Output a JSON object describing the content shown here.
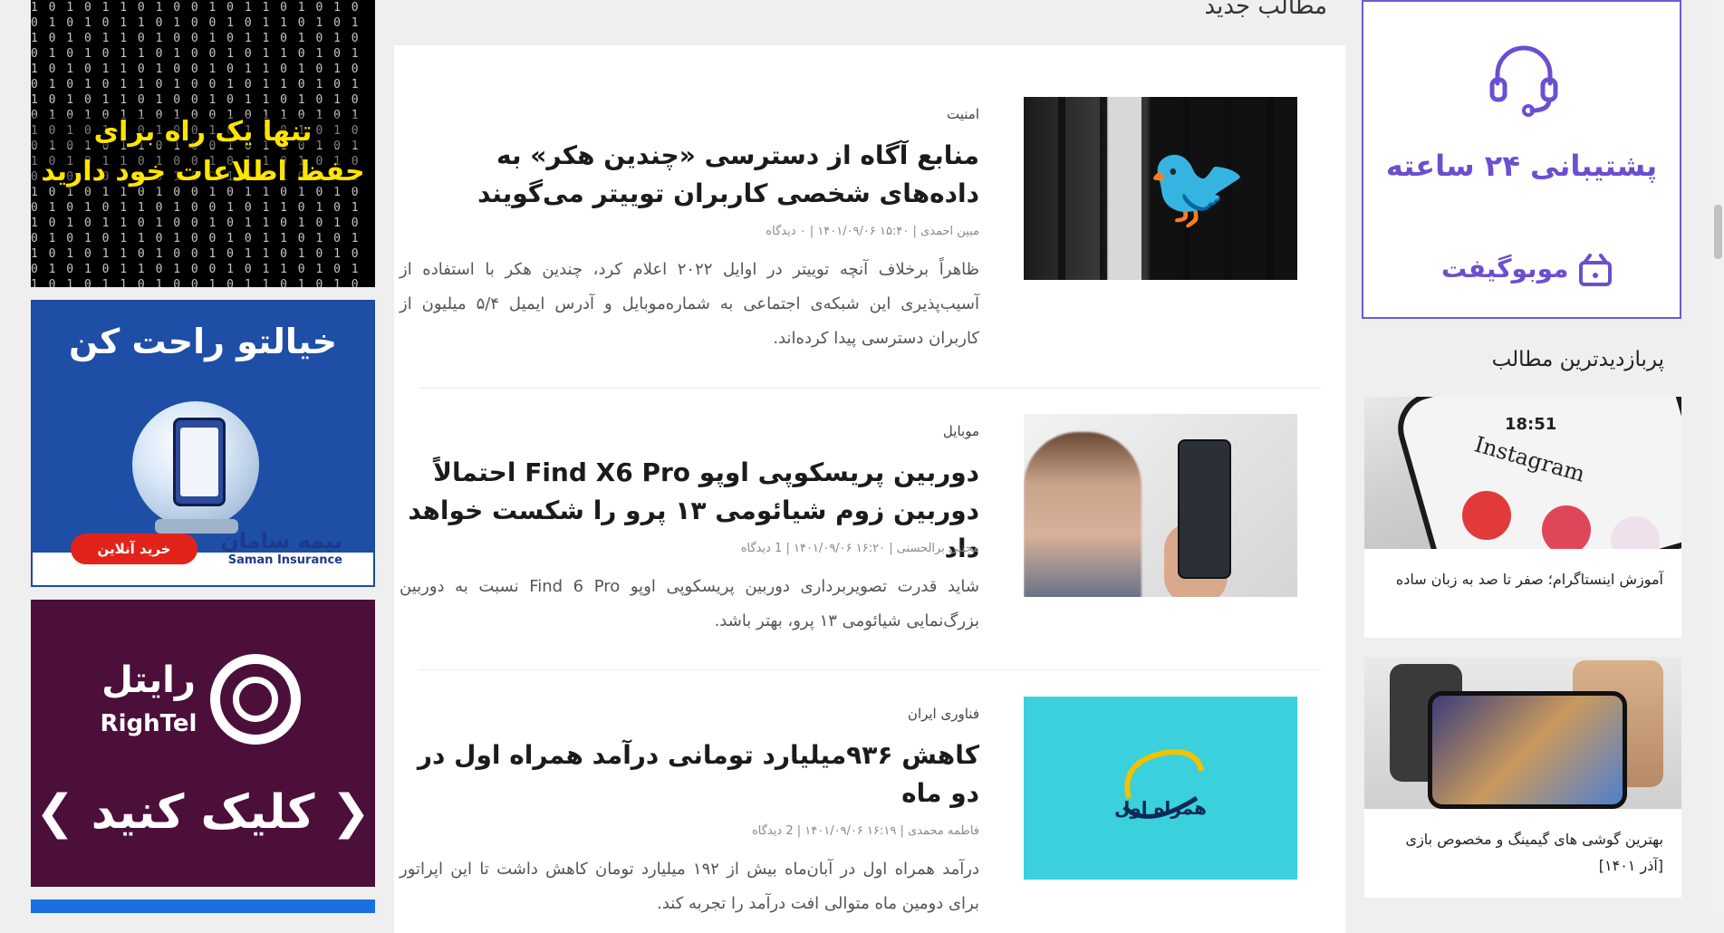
{
  "section": {
    "title": "مطالب جدید"
  },
  "left_ads": {
    "ad1": {
      "line1": "تنها یک راه برای",
      "line2": "حفظ اطلاعات خود دارید",
      "matrix": "1 0 1 0 1 1 0 1 0 0 1 0 1 1 0 1 0 1 0"
    },
    "ad2": {
      "headline": "خیالتو راحت کن",
      "button": "خرید آنلاین",
      "brand_fa": "بیمه سامان",
      "brand_en": "Saman Insurance"
    },
    "ad3": {
      "brand_fa": "رایتل",
      "brand_en": "RighTel",
      "cta": "❮ کلیک کنید ❯"
    }
  },
  "posts": [
    {
      "category": "امنیت",
      "title": "منابع آگاه از دسترسی «چندین هکر» به داده‌های شخصی کاربران توییتر می‌گویند",
      "meta": "مبین احمدی | ۱۵:۴۰ ۱۴۰۱/۰۹/۰۶ | ۰ دیدگاه",
      "excerpt": "ظاهراً برخلاف آنچه توییتر در اوایل ۲۰۲۲ اعلام کرد، چندین هکر با استفاده از آسیب‌پذیری این شبکه‌ی اجتماعی به شماره‌موبایل و آدرس ایمیل ۵/۴ میلیون از کاربران دسترسی پیدا کرده‌اند."
    },
    {
      "category": "موبایل",
      "title": "دوربین پریسکوپی اوپو Find X6 Pro احتمالاً دوربین زوم شیائومی ۱۳ پرو را شکست خواهد داد",
      "meta": "مجتبی برالحسنی | ۱۶:۲۰ ۱۴۰۱/۰۹/۰۶ | 1 دیدگاه",
      "excerpt": "شاید قدرت تصویربرداری دوربین پریسکوپی اوپو Find 6 Pro نسبت به دوربین بزرگ‌نمایی شیائومی ۱۳ پرو، بهتر باشد."
    },
    {
      "category": "فناوری ایران",
      "title": "کاهش ۹۳۶میلیارد تومانی درآمد همراه اول در دو ماه",
      "meta": "فاطمه محمدی | ۱۶:۱۹ ۱۴۰۱/۰۹/۰۶ | 2 دیدگاه",
      "excerpt": "درآمد همراه اول در آبان‌ماه بیش از ۱۹۲ میلیارد تومان کاهش داشت تا این اپراتور برای دومین ماه متوالی افت درآمد را تجربه کند."
    }
  ],
  "sidebar": {
    "support_ad": {
      "line1": "پشتیبانی ۲۴ ساعته",
      "brand": "موبوگیفت"
    },
    "popular_title": "پربازدیدترین مطالب",
    "cards": [
      {
        "caption": "آموزش اینستاگرام؛ صفر تا صد به زبان ساده",
        "img_time": "18:51",
        "img_app": "Instagram"
      },
      {
        "caption": "بهترین گوشی های گیمینگ و مخصوص بازی [آذر ۱۴۰۱]"
      }
    ]
  },
  "thumbs": {
    "hamrah_logo_text": "همراه اول"
  },
  "colors": {
    "accent_purple": "#6b4fd0",
    "hamrah_bg": "#3ad0dc",
    "saman_blue": "#1e4ea6",
    "rightel_bg": "#4b0f3a"
  }
}
